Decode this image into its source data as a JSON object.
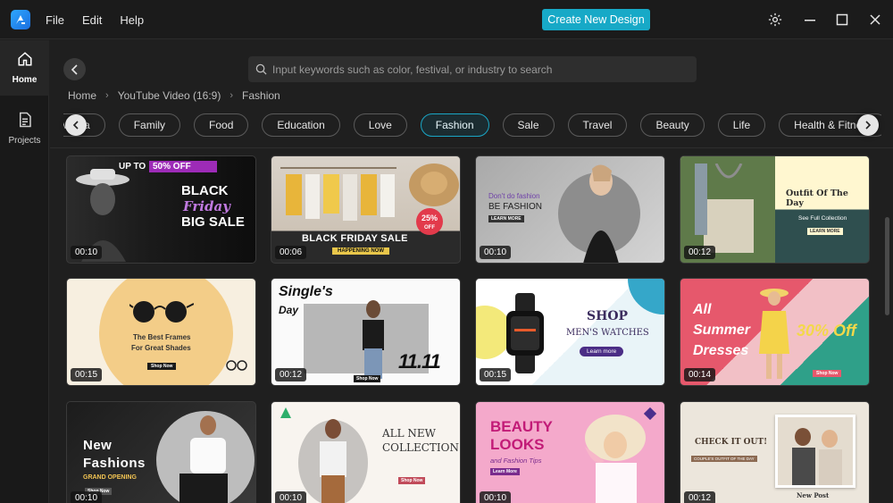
{
  "menu": {
    "file": "File",
    "edit": "Edit",
    "help": "Help"
  },
  "create_button": "Create New Design",
  "rail": {
    "home": "Home",
    "projects": "Projects"
  },
  "search": {
    "placeholder": "Input keywords such as color, festival, or industry to search",
    "value": ""
  },
  "breadcrumb": [
    "Home",
    "YouTube Video (16:9)",
    "Fashion"
  ],
  "chips": [
    "Media",
    "Family",
    "Food",
    "Education",
    "Love",
    "Fashion",
    "Sale",
    "Travel",
    "Beauty",
    "Life",
    "Health & Fitness"
  ],
  "active_chip": "Fashion",
  "colors": {
    "accent": "#17a9c7",
    "bg": "#1f1f1f"
  },
  "cards": [
    {
      "duration": "00:10",
      "texts": [
        "UP TO",
        "50% OFF",
        "BLACK",
        "Friday",
        "BIG SALE"
      ]
    },
    {
      "duration": "00:06",
      "texts": [
        "BLACK FRIDAY SALE",
        "HAPPENING NOW",
        "25%",
        "OFF"
      ]
    },
    {
      "duration": "00:10",
      "texts": [
        "Don't do fashion",
        "BE FASHION",
        "LEARN MORE"
      ]
    },
    {
      "duration": "00:12",
      "texts": [
        "Outfit Of The Day",
        "See Full Collection",
        "LEARN MORE"
      ]
    },
    {
      "duration": "00:15",
      "texts": [
        "The Best Frames",
        "For Great Shades",
        "Shop Now"
      ]
    },
    {
      "duration": "00:12",
      "texts": [
        "Single's",
        "Day",
        "11.11",
        "Shop Now"
      ]
    },
    {
      "duration": "00:15",
      "texts": [
        "SHOP",
        "MEN'S WATCHES",
        "Learn more"
      ]
    },
    {
      "duration": "00:14",
      "texts": [
        "All",
        "Summer",
        "Dresses",
        "30% Off",
        "Shop Now"
      ]
    },
    {
      "duration": "00:10",
      "texts": [
        "New",
        "Fashions",
        "GRAND OPENING",
        "Shop Now"
      ]
    },
    {
      "duration": "00:10",
      "texts": [
        "ALL NEW",
        "COLLECTION",
        "Shop Now"
      ]
    },
    {
      "duration": "00:10",
      "texts": [
        "BEAUTY",
        "LOOKS",
        "and Fashion Tips",
        "Learn More"
      ]
    },
    {
      "duration": "00:12",
      "texts": [
        "CHECK IT OUT!",
        "COUPLE'S OUTFIT OF THE DAY",
        "New Post"
      ]
    }
  ]
}
